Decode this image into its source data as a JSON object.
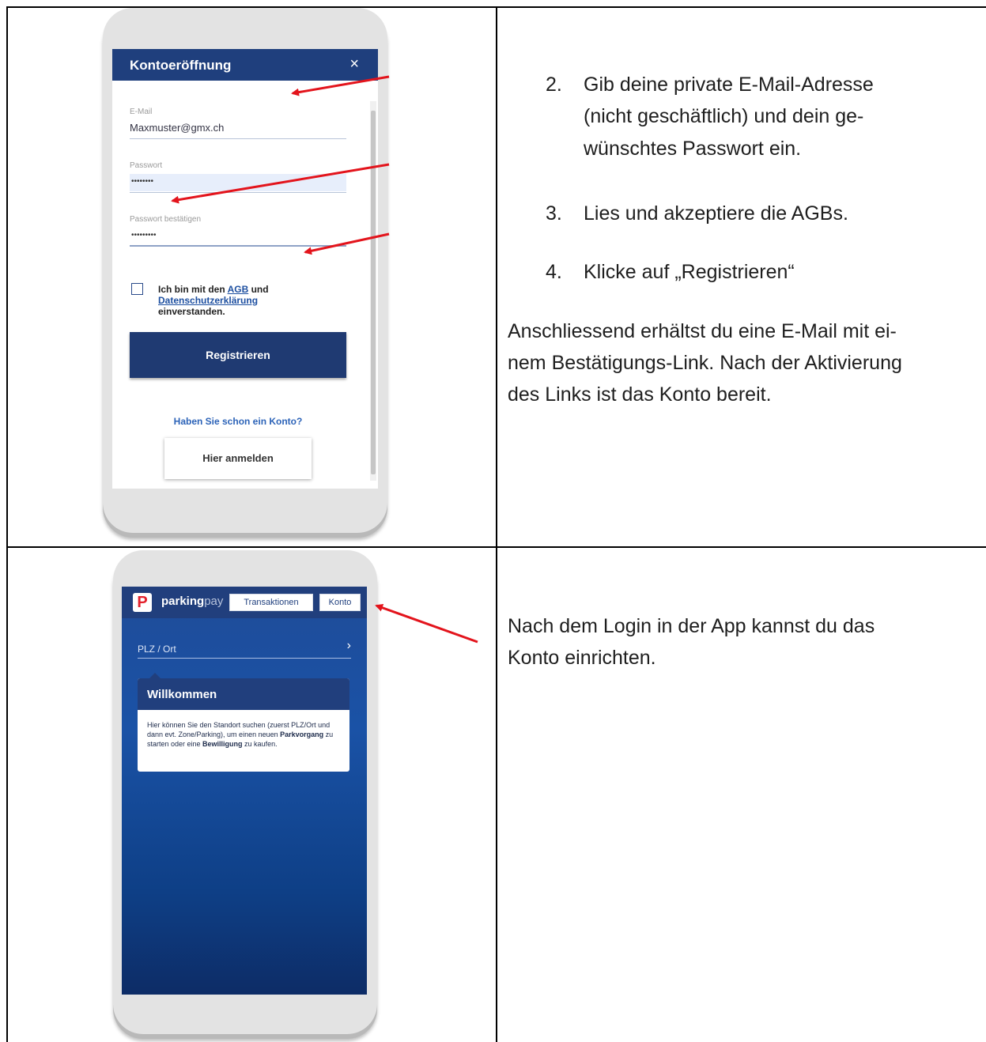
{
  "registration": {
    "title": "Kontoeröffnung",
    "close_icon": "×",
    "email_label": "E-Mail",
    "email_value": "Maxmuster@gmx.ch",
    "password_label": "Passwort",
    "password_dots": "••••••••",
    "confirm_label": "Passwort bestätigen",
    "confirm_dots": "•••••••••",
    "agree_prefix": "Ich bin mit den ",
    "agree_agb": "AGB",
    "agree_und": " und",
    "agree_privacy": "Datenschutzerklärung",
    "agree_suffix": "einverstanden.",
    "register_button": "Registrieren",
    "already_account": "Haben Sie schon ein Konto?",
    "login_button": "Hier anmelden"
  },
  "parkingpay": {
    "logo_letter": "P",
    "brand_parking": "parking",
    "brand_pay": "pay",
    "tab_transactions": "Transaktionen",
    "tab_account": "Konto",
    "plz_label": "PLZ / Ort",
    "chevron": "›",
    "welcome_title": "Willkommen",
    "welcome_text_1": "Hier können Sie den Standort suchen (zuerst PLZ/Ort und dann evt. Zone/Parking), um einen neuen ",
    "welcome_bold_1": "Parkvorgang",
    "welcome_text_2": " zu starten oder eine ",
    "welcome_bold_2": "Bewilligung",
    "welcome_text_3": " zu kaufen."
  },
  "instructions": {
    "step2_num": "2.",
    "step2_line1": "Gib deine private E-Mail-Adresse",
    "step2_line2": "(nicht geschäftlich) und dein ge-",
    "step2_line3": "wünschtes Passwort ein.",
    "step3_num": "3.",
    "step3_text": "Lies und akzeptiere die AGBs.",
    "step4_num": "4.",
    "step4_text": "Klicke auf „Registrieren“",
    "after_line1": "Anschliessend erhältst du eine E-Mail mit ei-",
    "after_line2": "nem Bestätigungs-Link. Nach der Aktivierung",
    "after_line3": "des Links ist das Konto bereit.",
    "login_line1": "Nach dem Login in der App kannst du das",
    "login_line2": "Konto einrichten."
  },
  "colors": {
    "header_blue": "#1f3f7d",
    "arrow_red": "#e3141c"
  }
}
